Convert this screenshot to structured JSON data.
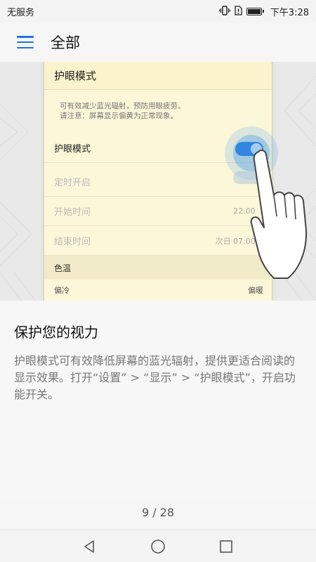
{
  "status_bar": {
    "carrier": "无服务",
    "time": "下午3:28",
    "icons": [
      "vibrate-icon",
      "no-sim-icon",
      "battery-icon"
    ]
  },
  "header": {
    "menu_icon": "hamburger-menu-icon",
    "title": "全部"
  },
  "illustration": {
    "screen_title": "护眼模式",
    "description_line1": "可有效减少蓝光辐射，预防用眼疲劳。",
    "description_line2": "请注意：屏幕显示偏黄为正常现象。",
    "eye_mode_label": "护眼模式",
    "eye_mode_on": true,
    "timer_label": "定时开启",
    "start_label": "开始时间",
    "start_value": "22:00",
    "end_label": "结束时间",
    "end_value": "次日 07:00",
    "color_temp_label": "色温",
    "cool_label": "偏冷",
    "warm_label": "偏暖"
  },
  "content": {
    "title": "保护您的视力",
    "body": "护眼模式可有效降低屏幕的蓝光辐射，提供更适合阅读的显示效果。打开“设置” > “显示” > “护眼模式”，开启功能开关。"
  },
  "pager": {
    "text": "9 / 28"
  },
  "nav_bar": {
    "icons": [
      "back-icon",
      "home-icon",
      "recents-icon"
    ]
  },
  "colors": {
    "accent": "#1a73e8",
    "toggle_on": "#1e72d9",
    "card_bg": "#fdf7d9"
  }
}
